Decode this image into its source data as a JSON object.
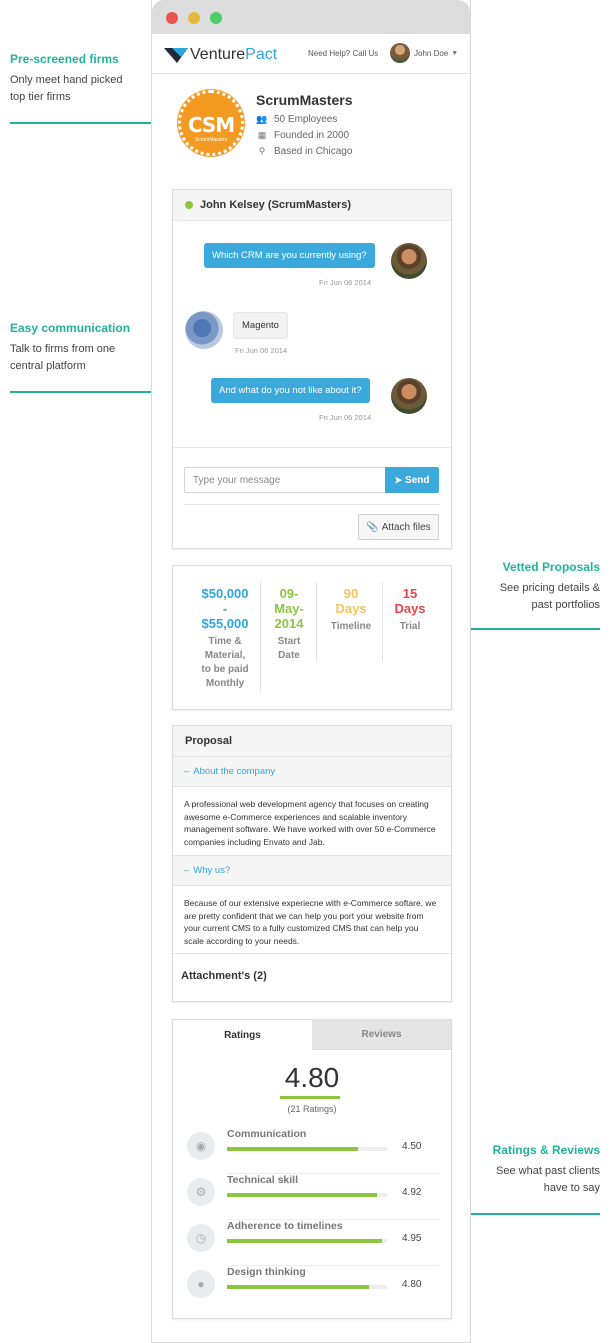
{
  "callouts": {
    "prescreened": {
      "title": "Pre-screened firms",
      "line1": "Only meet hand picked",
      "line2": "top tier firms"
    },
    "communication": {
      "title": "Easy communication",
      "line1": "Talk to firms from one",
      "line2": "central platform"
    },
    "proposals": {
      "title": "Vetted Proposals",
      "line1": "See pricing details &",
      "line2": "past portfolios"
    },
    "reviews": {
      "title": "Ratings & Reviews",
      "line1": "See what past clients",
      "line2": "have to say"
    }
  },
  "appbar": {
    "logo_prefix": "Venture",
    "logo_suffix": "Pact",
    "help": "Need Help? Call Us",
    "user": "John Doe"
  },
  "company": {
    "logo_text": "CSM",
    "logo_sub": "ScrumMasters",
    "name": "ScrumMasters",
    "employees": "50 Employees",
    "founded": "Founded in 2000",
    "location": "Based in Chicago"
  },
  "chat": {
    "title": "John Kelsey (ScrumMasters)",
    "messages": [
      {
        "text": "Which CRM are you currently using?",
        "time": "Fri Jun 06 2014"
      },
      {
        "text": "Magento",
        "time": "Fri Jun 06 2014"
      },
      {
        "text": "And what do you not like about it?",
        "time": "Fri Jun 06 2014"
      }
    ],
    "input_placeholder": "Type your message",
    "send_label": "Send",
    "attach_label": "Attach files"
  },
  "stats": [
    {
      "value_lines": [
        "$50,000",
        "-",
        "$55,000"
      ],
      "label_lines": [
        "Time &",
        "Material,",
        "to be paid",
        "Monthly"
      ],
      "color": "#2aa7df"
    },
    {
      "value_lines": [
        "09-",
        "May-",
        "2014"
      ],
      "label_lines": [
        "Start",
        "Date"
      ],
      "color": "#8cc63f"
    },
    {
      "value_lines": [
        "90",
        "Days"
      ],
      "label_lines": [
        "Timeline"
      ],
      "color": "#f5c45a"
    },
    {
      "value_lines": [
        "15",
        "Days"
      ],
      "label_lines": [
        "Trial"
      ],
      "color": "#e2474c"
    }
  ],
  "proposal": {
    "title": "Proposal",
    "about_title": "About the company",
    "about_text": "A professional web development agency that focuses on creating awesome e-Commerce experiences and scalable inventory management software. We have worked with over 50 e-Commerce companies including Envato and Jab.",
    "why_title": "Why us?",
    "why_text": "Because of our extensive experiecne with e-Commerce softare, we are pretty confident that we can help you port your website from your current CMS to a fully customized CMS that can help you scale according to your needs.",
    "attachments": "Attachment's (2)"
  },
  "ratings": {
    "tab_ratings": "Ratings",
    "tab_reviews": "Reviews",
    "overall": "4.80",
    "count": "(21 Ratings)",
    "criteria": [
      {
        "label": "Communication",
        "value": "4.50",
        "icon": "chat-icon",
        "fraction": 0.82
      },
      {
        "label": "Technical skill",
        "value": "4.92",
        "icon": "gears-icon",
        "fraction": 0.94
      },
      {
        "label": "Adherence to timelines",
        "value": "4.95",
        "icon": "clock-icon",
        "fraction": 0.97
      },
      {
        "label": "Design thinking",
        "value": "4.80",
        "icon": "user-icon",
        "fraction": 0.89
      }
    ]
  }
}
